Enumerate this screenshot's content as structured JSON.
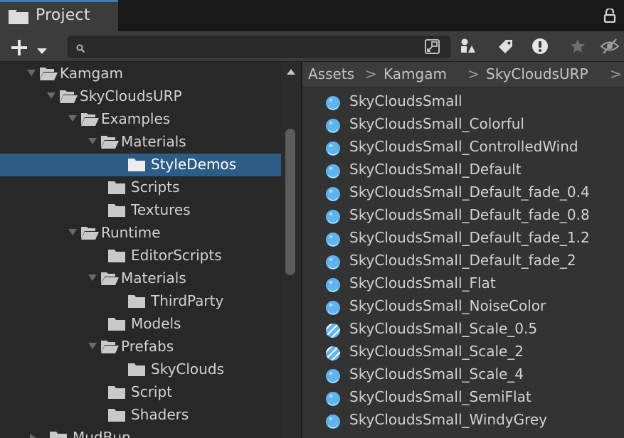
{
  "window": {
    "tab_title": "Project"
  },
  "toolbar": {
    "create_label": "+",
    "search_placeholder": "",
    "search_value": ""
  },
  "tree": {
    "items": [
      {
        "label": "Kamgam",
        "expanded": true
      },
      {
        "label": "SkyCloudsURP",
        "expanded": true
      },
      {
        "label": "Examples",
        "expanded": true
      },
      {
        "label": "Materials",
        "expanded": true
      },
      {
        "label": "StyleDemos",
        "selected": true
      },
      {
        "label": "Scripts"
      },
      {
        "label": "Textures"
      },
      {
        "label": "Runtime",
        "expanded": true
      },
      {
        "label": "EditorScripts"
      },
      {
        "label": "Materials",
        "expanded": true
      },
      {
        "label": "ThirdParty"
      },
      {
        "label": "Models"
      },
      {
        "label": "Prefabs",
        "expanded": true
      },
      {
        "label": "SkyClouds"
      },
      {
        "label": "Script"
      },
      {
        "label": "Shaders"
      },
      {
        "label": "MudBun",
        "expanded": false
      }
    ]
  },
  "breadcrumb": {
    "items": [
      "Assets",
      "Kamgam",
      "SkyCloudsURP"
    ],
    "separator": ">"
  },
  "assets": {
    "items": [
      {
        "label": "SkyCloudsSmall",
        "icon": "material-sphere-icon"
      },
      {
        "label": "SkyCloudsSmall_Colorful",
        "icon": "material-sphere-icon"
      },
      {
        "label": "SkyCloudsSmall_ControlledWind",
        "icon": "material-sphere-icon"
      },
      {
        "label": "SkyCloudsSmall_Default",
        "icon": "material-sphere-icon"
      },
      {
        "label": "SkyCloudsSmall_Default_fade_0.4",
        "icon": "material-sphere-icon"
      },
      {
        "label": "SkyCloudsSmall_Default_fade_0.8",
        "icon": "material-sphere-icon"
      },
      {
        "label": "SkyCloudsSmall_Default_fade_1.2",
        "icon": "material-sphere-icon"
      },
      {
        "label": "SkyCloudsSmall_Default_fade_2",
        "icon": "material-sphere-icon"
      },
      {
        "label": "SkyCloudsSmall_Flat",
        "icon": "material-sphere-icon"
      },
      {
        "label": "SkyCloudsSmall_NoiseColor",
        "icon": "material-sphere-icon"
      },
      {
        "label": "SkyCloudsSmall_Scale_0.5",
        "icon": "striped-material-sphere-icon"
      },
      {
        "label": "SkyCloudsSmall_Scale_2",
        "icon": "striped-material-sphere-icon"
      },
      {
        "label": "SkyCloudsSmall_Scale_4",
        "icon": "material-sphere-icon"
      },
      {
        "label": "SkyCloudsSmall_SemiFlat",
        "icon": "material-sphere-icon"
      },
      {
        "label": "SkyCloudsSmall_WindyGrey",
        "icon": "material-sphere-icon"
      }
    ]
  },
  "colors": {
    "selection": "#2c5d87",
    "accent_tab": "#3a79bb",
    "panel_bg": "#282828",
    "asset_panel_bg": "#333333",
    "icon_blue": "#5eb4ee"
  }
}
